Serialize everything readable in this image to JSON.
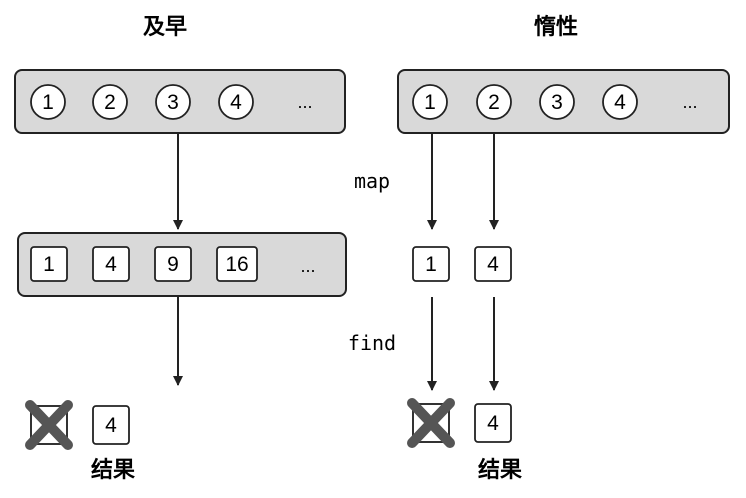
{
  "eager": {
    "title": "及早",
    "input_items": [
      "1",
      "2",
      "3",
      "4",
      "..."
    ],
    "mapped_items": [
      "1",
      "4",
      "9",
      "16",
      "..."
    ],
    "result_value": "4",
    "result_label": "结果"
  },
  "lazy": {
    "title": "惰性",
    "input_items": [
      "1",
      "2",
      "3",
      "4",
      "..."
    ],
    "mapped_items": [
      "1",
      "4"
    ],
    "map_label": "map",
    "find_label": "find",
    "result_value": "4",
    "result_label": "结果"
  },
  "colors": {
    "container_fill": "#d9d9d9",
    "stroke": "#222222",
    "cross": "#555555"
  }
}
